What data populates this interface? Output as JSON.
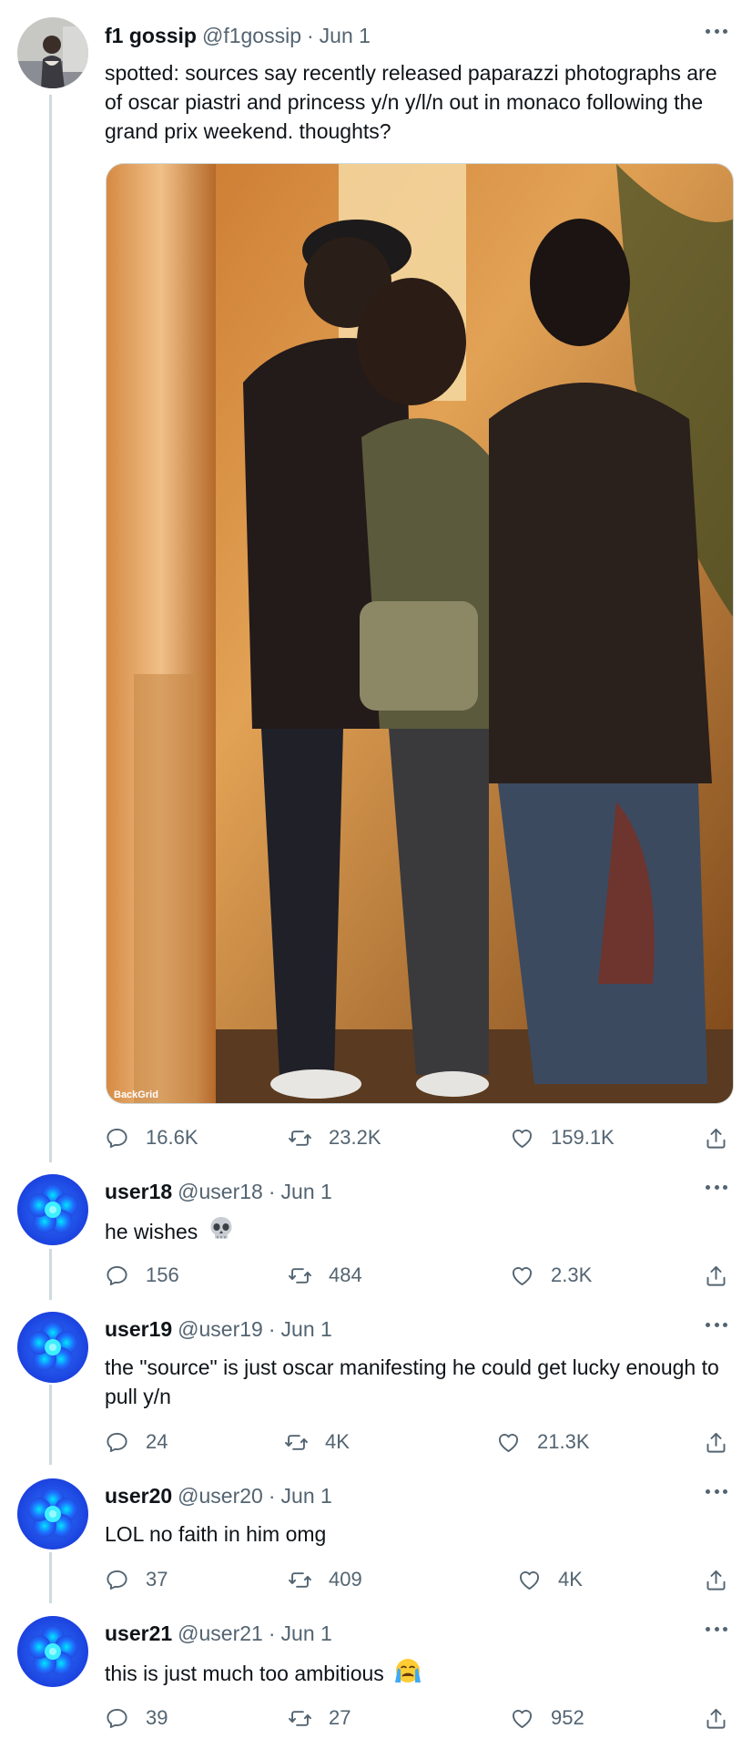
{
  "colors": {
    "text": "#0f1419",
    "secondary": "#536471",
    "thread_line": "#cfd9de",
    "avatar_flower": "#2b6bff"
  },
  "main_tweet": {
    "avatar_icon": "profile-photo",
    "name": "f1 gossip",
    "handle": "@f1gossip",
    "separator": "·",
    "date": "Jun 1",
    "text": "spotted: sources say recently released paparazzi photographs are of oscar piastri and princess y/n y/l/n out in monaco following the grand prix weekend. thoughts?",
    "photo_credit": "BackGrid",
    "stats": {
      "replies": "16.6K",
      "retweets": "23.2K",
      "likes": "159.1K"
    }
  },
  "replies": [
    {
      "name": "user18",
      "handle": "@user18",
      "separator": "·",
      "date": "Jun 1",
      "text": "he wishes",
      "emoji": "skull-emoji",
      "stats": {
        "replies": "156",
        "retweets": "484",
        "likes": "2.3K"
      }
    },
    {
      "name": "user19",
      "handle": "@user19",
      "separator": "·",
      "date": "Jun 1",
      "text": "the \"source\" is just oscar manifesting he could get lucky enough to pull y/n",
      "stats": {
        "replies": "24",
        "retweets": "4K",
        "likes": "21.3K"
      }
    },
    {
      "name": "user20",
      "handle": "@user20",
      "separator": "·",
      "date": "Jun 1",
      "text": "LOL no faith in him omg",
      "stats": {
        "replies": "37",
        "retweets": "409",
        "likes": "4K"
      }
    },
    {
      "name": "user21",
      "handle": "@user21",
      "separator": "·",
      "date": "Jun 1",
      "text": "this is just much too ambitious",
      "emoji": "crying-face-emoji",
      "stats": {
        "replies": "39",
        "retweets": "27",
        "likes": "952"
      }
    }
  ],
  "icons": {
    "reply": "reply-icon",
    "retweet": "retweet-icon",
    "like": "heart-icon",
    "share": "share-icon",
    "more": "more-icon"
  }
}
